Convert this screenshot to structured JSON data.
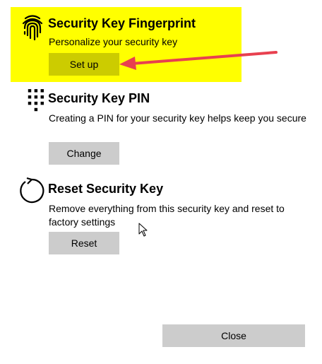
{
  "colors": {
    "highlight": "#ffff00",
    "setup_button": "#cccc00",
    "button": "#cccccc",
    "arrow": "#e8404f"
  },
  "fingerprint": {
    "icon": "fingerprint-icon",
    "title": "Security Key Fingerprint",
    "description": "Personalize your security key",
    "button_label": "Set up"
  },
  "pin": {
    "icon": "keypad-icon",
    "title": "Security Key PIN",
    "description": "Creating a PIN for your security key helps keep you secure",
    "button_label": "Change"
  },
  "reset": {
    "icon": "reset-icon",
    "title": "Reset Security Key",
    "description": "Remove everything from this security key and reset to factory settings",
    "button_label": "Reset"
  },
  "footer": {
    "close_label": "Close"
  }
}
